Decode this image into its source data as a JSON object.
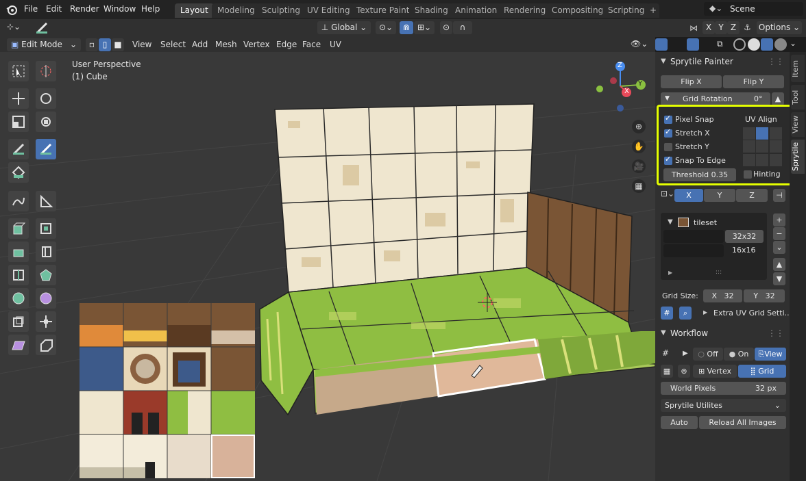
{
  "menus": [
    "File",
    "Edit",
    "Render",
    "Window",
    "Help"
  ],
  "workspaces": [
    "Layout",
    "Modeling",
    "Sculpting",
    "UV Editing",
    "Texture Paint",
    "Shading",
    "Animation",
    "Rendering",
    "Compositing",
    "Scripting"
  ],
  "active_workspace": "Layout",
  "scene": {
    "label": "Scene"
  },
  "header": {
    "transform_orientation": "Global",
    "axis_x": "X",
    "axis_y": "Y",
    "axis_z": "Z",
    "options": "Options",
    "mode": "Edit Mode",
    "view_menu": [
      "View",
      "Select",
      "Add",
      "Mesh",
      "Vertex",
      "Edge",
      "Face",
      "UV"
    ]
  },
  "viewport": {
    "perspective": "User Perspective",
    "object": "(1) Cube",
    "gizmo": {
      "z": "Z",
      "x": "X",
      "y": "Y"
    }
  },
  "tabs": {
    "item": "Item",
    "tool": "Tool",
    "view": "View",
    "sprytile": "Sprytile"
  },
  "sprytile": {
    "title": "Sprytile Painter",
    "flip_x": "Flip X",
    "flip_y": "Flip Y",
    "grid_rotation_label": "Grid Rotation",
    "grid_rotation_value": "0°",
    "pixel_snap": "Pixel Snap",
    "stretch_x": "Stretch X",
    "stretch_y": "Stretch Y",
    "snap_to_edge": "Snap To Edge",
    "uv_align": "UV Align",
    "threshold_label": "Threshold",
    "threshold_value": "0.35",
    "hinting": "Hinting",
    "axis_x": "X",
    "axis_y": "Y",
    "axis_z": "Z",
    "tileset_name": "tileset",
    "grid_32": "32x32",
    "grid_16": "16x16",
    "grid_size_label": "Grid Size:",
    "grid_x_label": "X",
    "grid_x_value": "32",
    "grid_y_label": "Y",
    "grid_y_value": "32",
    "extra_uv": "Extra UV Grid Setti...",
    "add": "+",
    "remove": "−",
    "dots": ":::"
  },
  "workflow": {
    "title": "Workflow",
    "off": "Off",
    "on": "On",
    "view": "View",
    "vertex": "Vertex",
    "grid": "Grid",
    "world_pixels_label": "World Pixels",
    "world_pixels_value": "32 px",
    "utilities": "Sprytile Utilites",
    "auto": "Auto",
    "reload": "Reload All Images"
  },
  "colors": {
    "accent": "#4772b3",
    "highlight": "#e5ff00",
    "panel": "#303030",
    "viewport": "#393939"
  }
}
